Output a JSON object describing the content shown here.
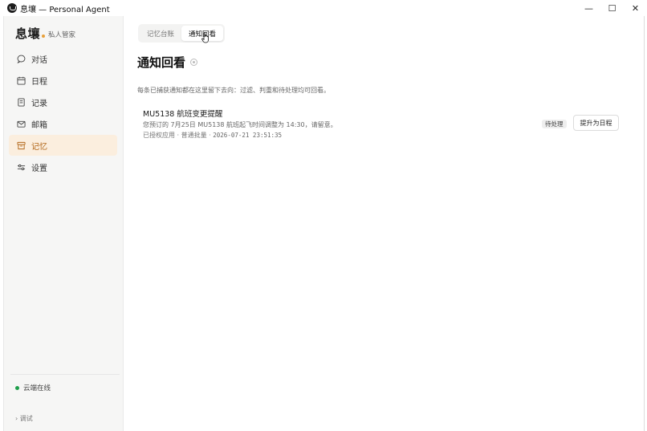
{
  "window": {
    "title": "息壤 — Personal Agent",
    "controls": {
      "minimize": "—",
      "maximize": "☐",
      "close": "✕"
    }
  },
  "sidebar": {
    "brand": "息壤",
    "brand_subtitle": "私人管家",
    "brand_dot_color": "#e8a03a",
    "items": [
      {
        "label": "对话",
        "icon": "chat-bubble-icon",
        "active": false
      },
      {
        "label": "日程",
        "icon": "calendar-icon",
        "active": false
      },
      {
        "label": "记录",
        "icon": "notebook-icon",
        "active": false
      },
      {
        "label": "邮箱",
        "icon": "mail-icon",
        "active": false
      },
      {
        "label": "记忆",
        "icon": "archive-box-icon",
        "active": true
      },
      {
        "label": "设置",
        "icon": "sliders-icon",
        "active": false
      }
    ],
    "status": {
      "label": "云端在线",
      "color": "#1e9e4a"
    },
    "debug": {
      "label": "调试",
      "prefix": "›"
    }
  },
  "main": {
    "tabs": [
      {
        "label": "记忆台账",
        "active": false
      },
      {
        "label": "通知回看",
        "active": true
      }
    ],
    "page_title": "通知回看",
    "description": "每条已捕获通知都在这里留下去向：过滤、判重和待处理均可回看。",
    "notifications": [
      {
        "title": "MU5138 航班变更提醒",
        "body": "您预订的 7月25日 MU5138 航班起飞时间调整为 14:30，请留意。",
        "meta": "已授权应用 · 普通批量 · ",
        "time": "2026-07-21 23:51:35",
        "status_badge": "待处理",
        "action_label": "提升为日程"
      }
    ]
  },
  "colors": {
    "accent": "#b2681b",
    "active_bg": "#fbeede"
  }
}
